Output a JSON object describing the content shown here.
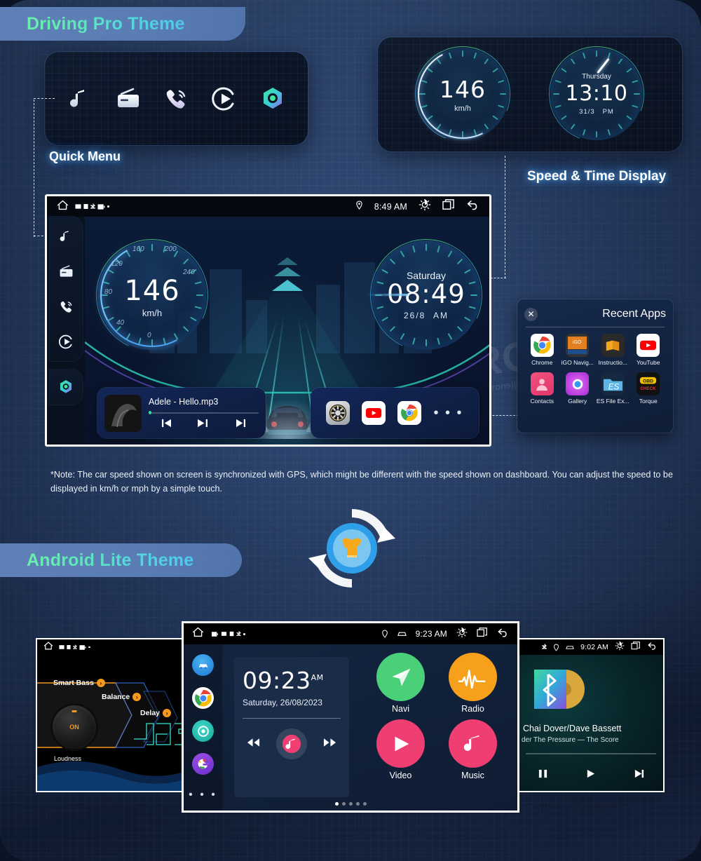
{
  "sections": {
    "driving_pro_title": "Driving Pro Theme",
    "android_lite_title": "Android Lite Theme"
  },
  "callouts": {
    "quick_menu": "Quick Menu",
    "speed_time": "Speed & Time Display"
  },
  "quick_menu": {
    "icons": [
      {
        "name": "music-note-icon",
        "label": "Music"
      },
      {
        "name": "radio-icon",
        "label": "Radio"
      },
      {
        "name": "phone-call-icon",
        "label": "Phone"
      },
      {
        "name": "video-play-icon",
        "label": "Video"
      },
      {
        "name": "apps-hex-icon",
        "label": "Apps"
      }
    ]
  },
  "speed_time_panel": {
    "speed": {
      "value": "146",
      "unit": "km/h"
    },
    "clock": {
      "weekday": "Thursday",
      "time": "13:10",
      "date": "31/3",
      "meridiem": "PM"
    }
  },
  "main_screen": {
    "status_bar": {
      "home_icon": "home-icon",
      "left_icons": [
        "sd-card-icon",
        "usb-icon",
        "bluetooth-icon",
        "battery-icon",
        "dot-icon"
      ],
      "location_icon": "location-pin-icon",
      "time": "8:49 AM",
      "brightness_icon": "brightness-icon",
      "recents_icon": "recent-apps-icon",
      "back_icon": "back-arrow-icon"
    },
    "sidebar": [
      {
        "name": "sidebar-music-icon",
        "label": "Music"
      },
      {
        "name": "sidebar-radio-icon",
        "label": "Radio"
      },
      {
        "name": "sidebar-phone-icon",
        "label": "Phone"
      },
      {
        "name": "sidebar-video-icon",
        "label": "Video"
      },
      {
        "name": "sidebar-apps-icon",
        "label": "Apps"
      }
    ],
    "speedometer": {
      "value": "146",
      "unit": "km/h",
      "ticks": [
        "0",
        "40",
        "80",
        "120",
        "160",
        "200",
        "240"
      ]
    },
    "clock": {
      "weekday": "Saturday",
      "time": "08:49",
      "date": "26/8",
      "meridiem": "AM"
    },
    "media_card": {
      "track": "Adele - Hello.mp3",
      "prev_icon": "previous-track-icon",
      "play_pause_icon": "play-pause-icon",
      "next_icon": "next-track-icon"
    },
    "app_card": {
      "apps": [
        {
          "name": "steering-wheel-app-icon",
          "label": "Car Settings"
        },
        {
          "name": "youtube-app-icon",
          "label": "YouTube"
        },
        {
          "name": "chrome-app-icon",
          "label": "Chrome"
        }
      ],
      "more": "• • •"
    }
  },
  "recent_apps": {
    "title": "Recent Apps",
    "close_icon": "close-icon",
    "apps": [
      {
        "name": "chrome-app-icon",
        "label": "Chrome"
      },
      {
        "name": "igo-navigation-app-icon",
        "label": "iGO Navig..."
      },
      {
        "name": "instructions-app-icon",
        "label": "Instructio..."
      },
      {
        "name": "youtube-app-icon",
        "label": "YouTube"
      },
      {
        "name": "contacts-app-icon",
        "label": "Contacts"
      },
      {
        "name": "gallery-app-icon",
        "label": "Gallery"
      },
      {
        "name": "es-file-explorer-app-icon",
        "label": "ES File Ex..."
      },
      {
        "name": "torque-obd-app-icon",
        "label": "Torque"
      }
    ]
  },
  "note": "*Note: The car speed shown on screen is synchronized with GPS, which might be different with the speed shown on dashboard. You can adjust the speed to be displayed in km/h or mph by a simple touch.",
  "eq_screen": {
    "status_bar": {
      "home_icon": "home-icon",
      "time": ""
    },
    "labels": {
      "smart_bass": "Smart Bass",
      "balance": "Balance",
      "delay": "Delay",
      "loudness": "Loudness",
      "knob_state": "ON"
    }
  },
  "lite_screen": {
    "status_bar": {
      "home_icon": "home-icon",
      "location_icon": "location-pin-icon",
      "car-icon": "car-icon",
      "time": "9:23 AM",
      "brightness_icon": "brightness-icon",
      "recents_icon": "recent-apps-icon",
      "back_icon": "back-arrow-icon"
    },
    "rail": [
      {
        "name": "rail-car-settings-icon",
        "label": "Car"
      },
      {
        "name": "rail-chrome-icon",
        "label": "Chrome"
      },
      {
        "name": "rail-settings-icon",
        "label": "Settings"
      },
      {
        "name": "rail-google-icon",
        "label": "Google"
      }
    ],
    "rail_more": "• • •",
    "clock": {
      "time": "09:23",
      "meridiem": "AM",
      "date": "Saturday, 26/08/2023"
    },
    "player": {
      "prev_icon": "rewind-icon",
      "disc_icon": "music-disc-icon",
      "next_icon": "forward-icon"
    },
    "apps": [
      {
        "name": "navi-app-icon",
        "label": "Navi"
      },
      {
        "name": "radio-app-icon",
        "label": "Radio"
      },
      {
        "name": "video-app-icon",
        "label": "Video"
      },
      {
        "name": "music-app-icon",
        "label": "Music"
      }
    ],
    "page_dots": 5,
    "active_dot": 1
  },
  "bt_screen": {
    "status_bar": {
      "bluetooth_icon": "bluetooth-icon",
      "location_icon": "location-pin-icon",
      "car_icon": "car-icon",
      "time": "9:02 AM",
      "brightness_icon": "brightness-icon",
      "recents_icon": "recent-apps-icon",
      "back_icon": "back-arrow-icon"
    },
    "artist": "Chai Dover/Dave Bassett",
    "track": "der The Pressure — The Score",
    "controls": {
      "pause_icon": "pause-icon",
      "play_icon": "play-icon",
      "next_icon": "next-track-icon"
    }
  },
  "watermarks": {
    "brand": "XTRONS",
    "copyright": "copyright by xtrons|||||||"
  },
  "colors": {
    "accent_green": "#5fe8a8",
    "accent_cyan": "#4cc8ee",
    "banner_blue": "#6082b9",
    "glow_blue": "#5ab4ff",
    "page_bg": "#2a4068"
  }
}
